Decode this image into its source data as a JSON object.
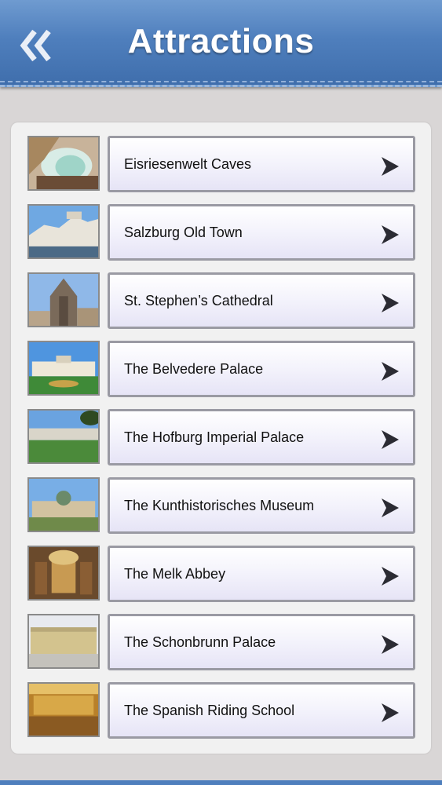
{
  "header": {
    "title": "Attractions",
    "back_icon": "double-chevron-left-icon"
  },
  "colors": {
    "header_blue": "#4f7fbd",
    "background": "#d9d6d6",
    "panel": "#f1f1f1"
  },
  "attractions": [
    {
      "label": "Eisriesenwelt Caves"
    },
    {
      "label": "Salzburg Old Town"
    },
    {
      "label": "St. Stephen’s Cathedral"
    },
    {
      "label": "The Belvedere Palace"
    },
    {
      "label": "The Hofburg Imperial Palace"
    },
    {
      "label": "The Kunthistorisches Museum"
    },
    {
      "label": "The Melk Abbey"
    },
    {
      "label": "The Schonbrunn Palace"
    },
    {
      "label": "The Spanish Riding School"
    }
  ]
}
